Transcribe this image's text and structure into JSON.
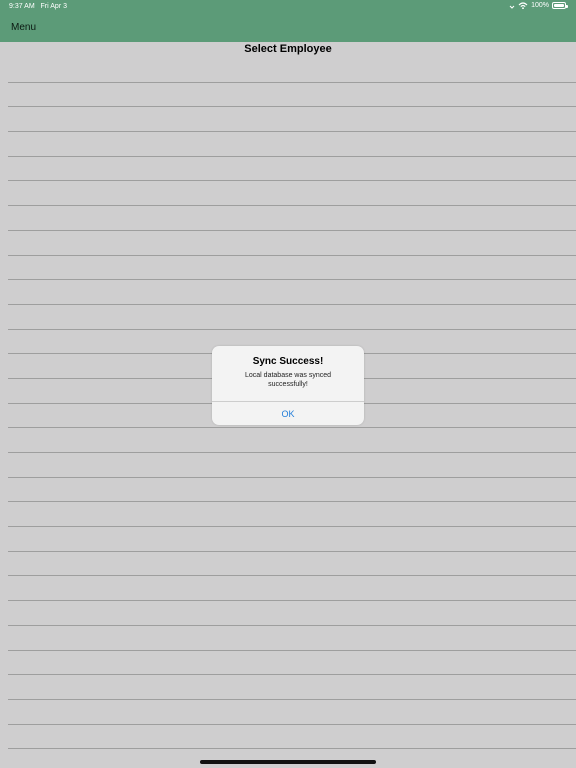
{
  "status_bar": {
    "time": "9:37 AM",
    "date": "Fri Apr 3",
    "battery": "100%",
    "icons": [
      "signal-icon",
      "wifi-icon",
      "battery-icon"
    ]
  },
  "nav_bar": {
    "menu_label": "Menu",
    "color": "#5c9b78"
  },
  "page": {
    "title": "Select Employee"
  },
  "alert": {
    "title": "Sync Success!",
    "message": "Local database was synced successfully!",
    "ok_label": "OK"
  }
}
